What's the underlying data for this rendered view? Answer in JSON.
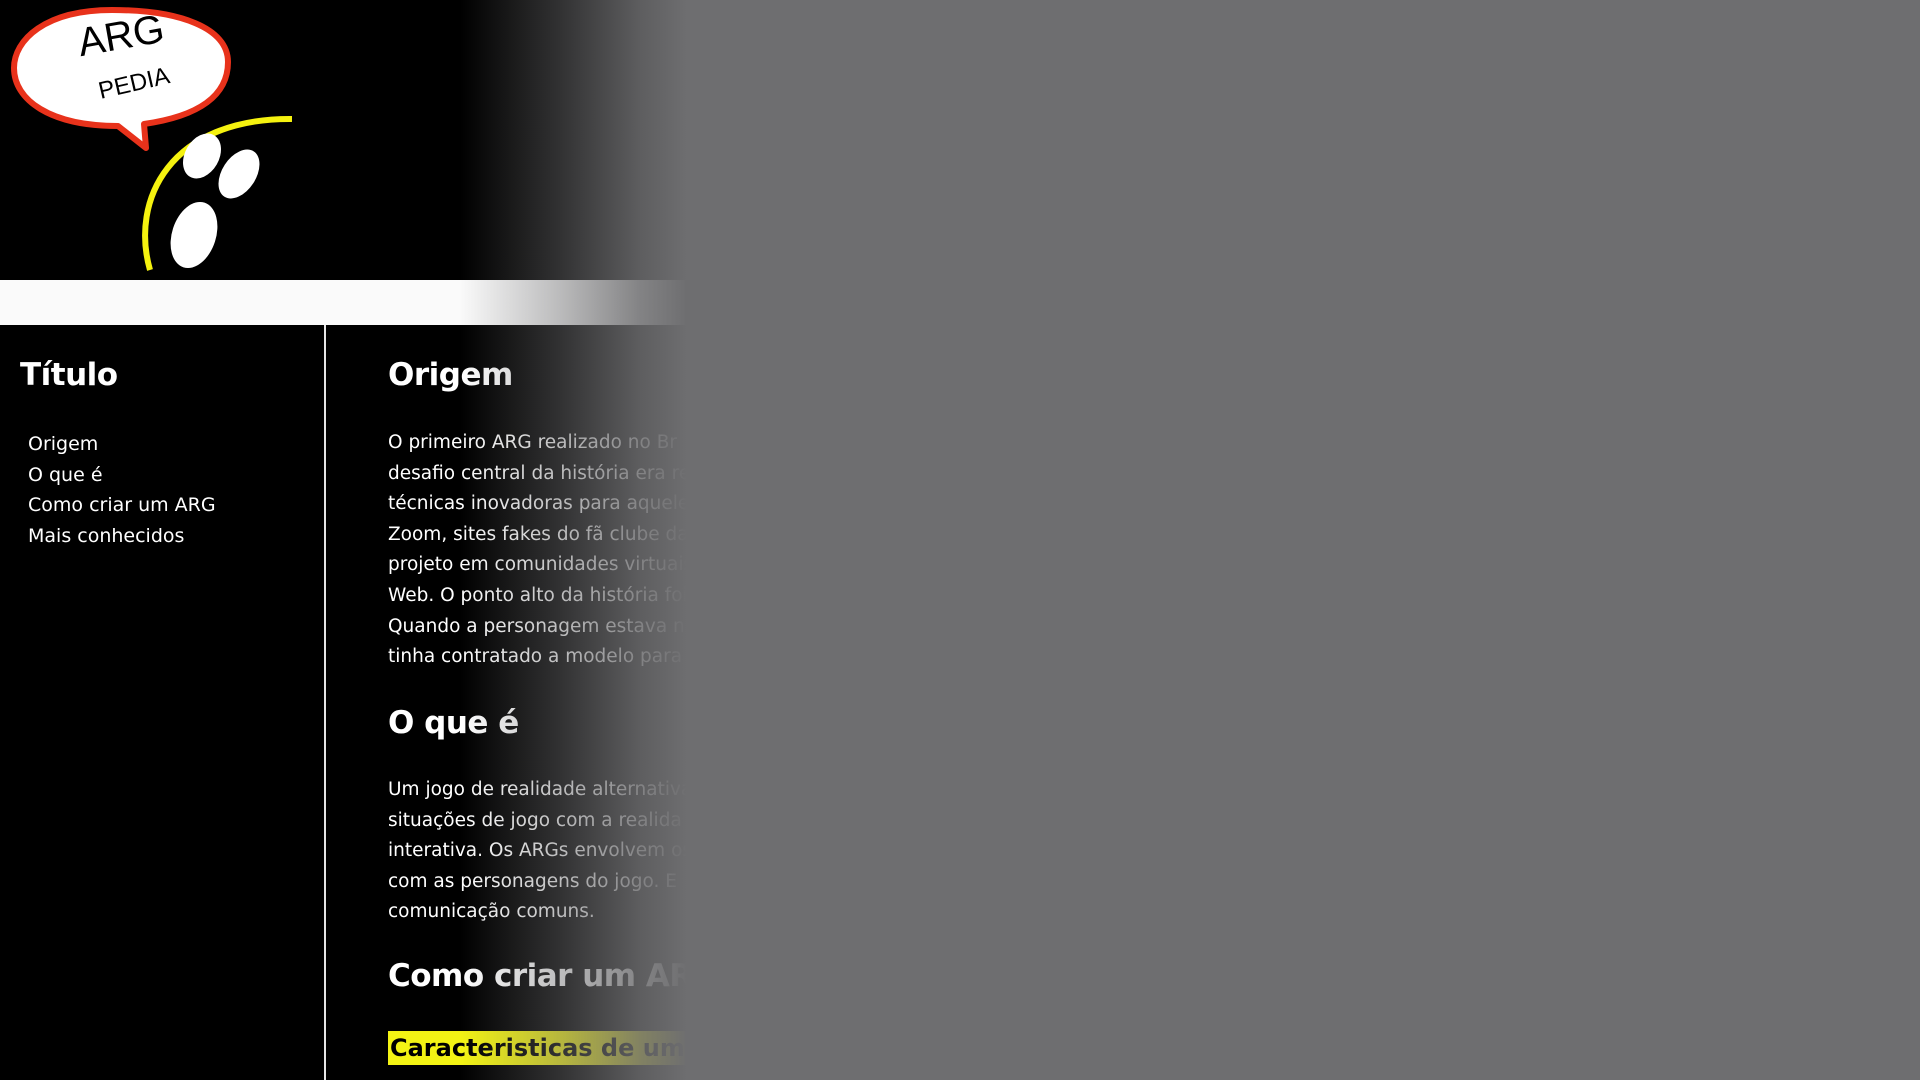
{
  "logo": {
    "line1": "ARG",
    "line2": "PEDIA",
    "colors": {
      "bubble_border": "#e8321b",
      "arc": "#f5f20f",
      "eyes": "#ffffff"
    }
  },
  "sidebar": {
    "title": "Título",
    "items": [
      {
        "label": "Origem"
      },
      {
        "label": "O que é"
      },
      {
        "label": "Como criar um ARG"
      },
      {
        "label": "Mais conhecidos"
      }
    ]
  },
  "content": {
    "sections": [
      {
        "heading": "Origem",
        "lines": [
          "O primeiro ARG realizado no Br",
          "desafio central da história era re",
          "técnicas inovadoras para aquele",
          "Zoom, sites fakes do fã clube da",
          "projeto em comunidades virtuais",
          "Web. O ponto alto da história foi",
          "Quando a personagem estava n",
          "tinha contratado a modelo para"
        ]
      },
      {
        "heading": "O que é",
        "lines": [
          "Um jogo de realidade alternativa",
          "situações de jogo com a realida",
          "interativa. Os ARGs envolvem os",
          "com as personagens do jogo. E",
          "comunicação comuns."
        ]
      },
      {
        "heading": "Como criar um ARG",
        "subheading": "Caracteristicas de um AR"
      }
    ]
  },
  "colors": {
    "page_background": "#000000",
    "viewport_background": "#6e6e70",
    "highlight": "#f3f314",
    "text": "#ffffff"
  }
}
